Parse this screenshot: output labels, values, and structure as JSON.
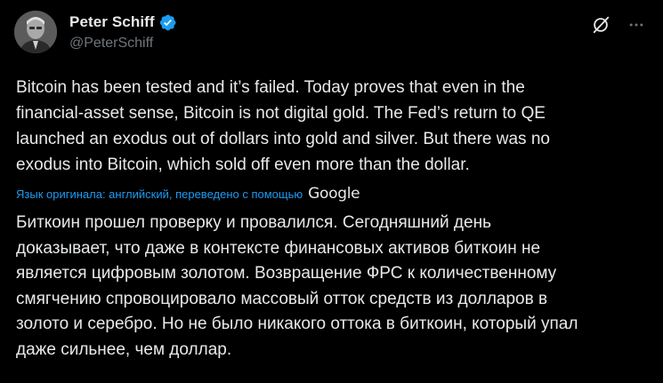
{
  "author": {
    "display_name": "Peter Schiff",
    "handle": "@PeterSchiff",
    "verified": true
  },
  "actions": {
    "grok_icon": "grok-icon",
    "more_icon": "more-horizontal-icon"
  },
  "tweet": {
    "text": "Bitcoin has been tested and it’s failed. Today proves that even in the\nfinancial-asset sense, Bitcoin is not digital gold. The Fed’s return to QE\nlaunched an exodus out of dollars into gold and silver. But there was no\nexodus into Bitcoin, which sold off even more than the dollar.",
    "translation_note": "Язык оригинала: английский, переведено с помощью",
    "translation_provider": "Google",
    "translated_text": "Биткоин прошел проверку и провалился. Сегодняшний день\nдоказывает, что даже в контексте финансовых активов биткоин не\nявляется цифровым золотом. Возвращение ФРС к количественному\nсмягчению спровоцировало массовый отток средств из долларов в\nзолото и серебро. Но не было никакого оттока в биткоин, который упал\nдаже сильнее, чем доллар."
  },
  "colors": {
    "background": "#000000",
    "text_primary": "#e7e9ea",
    "text_secondary": "#71767b",
    "accent": "#1d9bf0"
  }
}
